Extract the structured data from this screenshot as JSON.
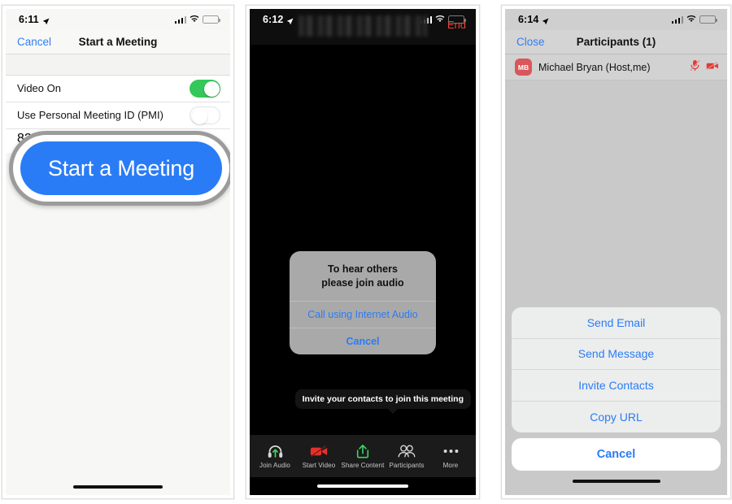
{
  "panels": [
    {
      "id": "start-a-meeting",
      "statusbar": {
        "time": "6:11",
        "location_icon": "location-arrow-icon",
        "cellular_icon": "cellular-bars-icon",
        "wifi_icon": "wifi-icon",
        "battery_icon": "battery-icon"
      },
      "navbar": {
        "left_button": "Cancel",
        "title": "Start a Meeting"
      },
      "settings": [
        {
          "label": "Video On",
          "toggle": "on"
        },
        {
          "label": "Use Personal Meeting ID (PMI)",
          "toggle": "off",
          "sub": "825"
        }
      ],
      "callout_button": {
        "label": "Start a Meeting",
        "color": "#2a7cf6",
        "ring_color": "#9b9b9b"
      }
    },
    {
      "id": "in-meeting",
      "statusbar": {
        "time": "6:12",
        "location_icon": "location-arrow-icon",
        "cellular_icon": "cellular-bars-icon",
        "wifi_icon": "wifi-icon",
        "battery_icon": "battery-icon"
      },
      "header": {
        "meeting_title": "",
        "end_button": "End",
        "end_color": "#e8453c"
      },
      "audio_dialog": {
        "message_line1": "To hear others",
        "message_line2": "please join audio",
        "primary_action": "Call using Internet Audio",
        "cancel_action": "Cancel"
      },
      "tooltip": "Invite your contacts to join this meeting",
      "toolbar": [
        {
          "label": "Join Audio",
          "icon": "headphones-icon"
        },
        {
          "label": "Start Video",
          "icon": "video-off-icon"
        },
        {
          "label": "Share Content",
          "icon": "share-up-icon"
        },
        {
          "label": "Participants",
          "icon": "participants-icon"
        },
        {
          "label": "More",
          "icon": "ellipsis-icon"
        }
      ]
    },
    {
      "id": "participants",
      "statusbar": {
        "time": "6:14",
        "location_icon": "location-arrow-icon",
        "cellular_icon": "cellular-bars-icon",
        "wifi_icon": "wifi-icon",
        "battery_icon": "battery-icon"
      },
      "navbar": {
        "left_button": "Close",
        "title": "Participants (1)"
      },
      "participant": {
        "initials": "MB",
        "name": "Michael Bryan (Host,me)",
        "avatar_color": "#d9575a",
        "mic_icon": "mic-muted-icon",
        "video_icon": "video-off-icon"
      },
      "action_sheet": {
        "items": [
          "Send Email",
          "Send Message",
          "Invite Contacts",
          "Copy URL"
        ],
        "cancel": "Cancel"
      }
    }
  ]
}
